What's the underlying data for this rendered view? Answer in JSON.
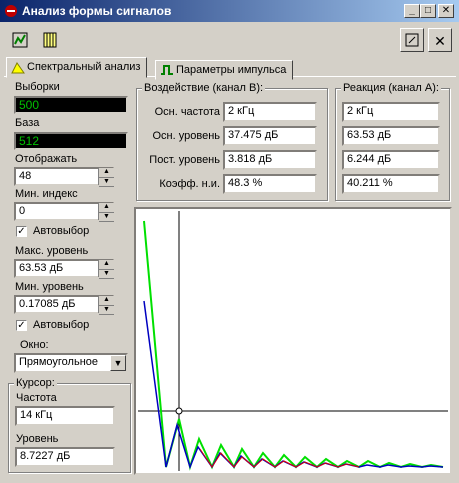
{
  "window": {
    "title": "Анализ формы сигналов"
  },
  "tabs": [
    {
      "label": "Спектральный анализ"
    },
    {
      "label": "Параметры импульса"
    }
  ],
  "left": {
    "samples_label": "Выборки",
    "samples_value": "500",
    "base_label": "База",
    "base_value": "512",
    "display_label": "Отображать",
    "display_value": "48",
    "min_index_label": "Мин. индекс",
    "min_index_value": "0",
    "autoselect1_label": "Автовыбор",
    "autoselect1_checked": true,
    "max_level_label": "Макс. уровень",
    "max_level_value": "63.53 дБ",
    "min_level_label": "Мин. уровень",
    "min_level_value": "0.17085 дБ",
    "autoselect2_label": "Автовыбор",
    "autoselect2_checked": true,
    "window_label": "Окно:",
    "window_value": "Прямоугольное",
    "cursor_group_label": "Курсор:",
    "cursor_freq_label": "Частота",
    "cursor_freq_value": "14 кГц",
    "cursor_level_label": "Уровень",
    "cursor_level_value": "8.7227 дБ"
  },
  "input_group": {
    "title": "Воздействие (канал B):",
    "rows": [
      {
        "label": "Осн. частота",
        "value": "2 кГц"
      },
      {
        "label": "Осн. уровень",
        "value": "37.475 дБ"
      },
      {
        "label": "Пост. уровень",
        "value": "3.818 дБ"
      },
      {
        "label": "Коэфф. н.и.",
        "value": "48.3 %"
      }
    ]
  },
  "response_group": {
    "title": "Реакция (канал А):",
    "values": [
      "2 кГц",
      "63.53 дБ",
      "6.244 дБ",
      "40.211 %"
    ]
  },
  "colors": {
    "green_series": "#00e000",
    "blue_series": "#0000c0",
    "red_series": "#e00000",
    "cursor": "#000000"
  }
}
